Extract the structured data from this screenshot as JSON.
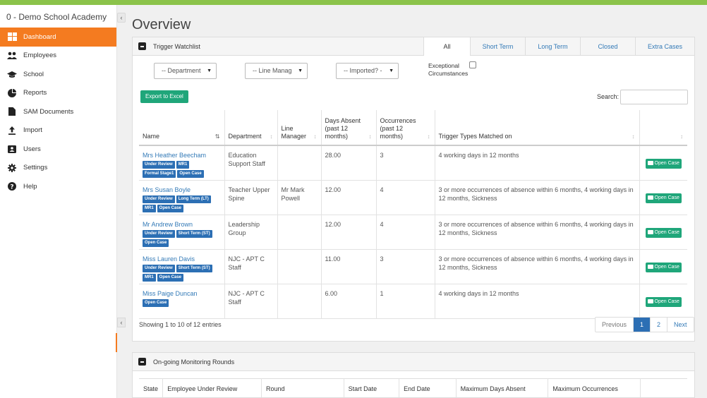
{
  "app": {
    "org_name": "0 - Demo School Academy",
    "accent": "#f47b20",
    "top_bar_color": "#8bc34a"
  },
  "sidebar": {
    "items": [
      {
        "label": "Dashboard",
        "icon": "dashboard-icon",
        "active": true
      },
      {
        "label": "Employees",
        "icon": "users-icon"
      },
      {
        "label": "School",
        "icon": "graduation-cap-icon"
      },
      {
        "label": "Reports",
        "icon": "pie-chart-icon"
      },
      {
        "label": "SAM Documents",
        "icon": "document-icon"
      },
      {
        "label": "Import",
        "icon": "upload-icon"
      },
      {
        "label": "Users",
        "icon": "user-card-icon"
      },
      {
        "label": "Settings",
        "icon": "gear-icon"
      },
      {
        "label": "Help",
        "icon": "question-icon"
      }
    ],
    "collapse_glyph": "‹"
  },
  "page": {
    "title": "Overview"
  },
  "watchlist": {
    "title": "Trigger Watchlist",
    "tabs": [
      "All",
      "Short Term",
      "Long Term",
      "Closed",
      "Extra Cases"
    ],
    "active_tab": "All",
    "filters": {
      "department": "-- Department",
      "line_manager": "-- Line Manag",
      "imported": "-- Imported? -",
      "exceptional": "Exceptional Circumstances"
    },
    "export_label": "Export to Excel",
    "search_label": "Search:",
    "columns": [
      "Name",
      "Department",
      "Line Manager",
      "Days Absent (past 12 months)",
      "Occurrences (past 12 months)",
      "Trigger Types Matched on",
      ""
    ],
    "rows": [
      {
        "name": "Mrs Heather Beecham",
        "badges": [
          "Under Review",
          "MR1",
          "Formal Stage1",
          "Open Case"
        ],
        "department": "Education Support Staff",
        "manager": "",
        "days": "28.00",
        "occ": "3",
        "triggers": "4 working days in 12 months",
        "action": "Open Case"
      },
      {
        "name": "Mrs Susan Boyle",
        "badges": [
          "Under Review",
          "Long Term (LT)",
          "MR1",
          "Open Case"
        ],
        "department": "Teacher Upper Spine",
        "manager": "Mr Mark Powell",
        "days": "12.00",
        "occ": "4",
        "triggers": "3 or more occurrences of absence within 6 months, 4 working days in 12 months, Sickness",
        "action": "Open Case"
      },
      {
        "name": "Mr Andrew Brown",
        "badges": [
          "Under Review",
          "Short Term (ST)",
          "Open Case"
        ],
        "department": "Leadership Group",
        "manager": "",
        "days": "12.00",
        "occ": "4",
        "triggers": "3 or more occurrences of absence within 6 months, 4 working days in 12 months, Sickness",
        "action": "Open Case"
      },
      {
        "name": "Miss Lauren Davis",
        "badges": [
          "Under Review",
          "Short Term (ST)",
          "MR1",
          "Open Case"
        ],
        "department": "NJC - APT C Staff",
        "manager": "",
        "days": "11.00",
        "occ": "3",
        "triggers": "3 or more occurrences of absence within 6 months, 4 working days in 12 months, Sickness",
        "action": "Open Case"
      },
      {
        "name": "Miss Paige Duncan",
        "badges": [
          "Open Case"
        ],
        "department": "NJC - APT C Staff",
        "manager": "",
        "days": "6.00",
        "occ": "1",
        "triggers": "4 working days in 12 months",
        "action": "Open Case"
      }
    ],
    "footer_info": "Showing 1 to 10 of 12 entries",
    "pager": [
      "Previous",
      "1",
      "2",
      "Next"
    ],
    "current_page": "1"
  },
  "monitoring": {
    "title": "On-going Monitoring Rounds",
    "columns": [
      "State",
      "Employee Under Review",
      "Round",
      "Start Date",
      "End Date",
      "Maximum Days Absent",
      "Maximum Occurrences",
      ""
    ]
  }
}
